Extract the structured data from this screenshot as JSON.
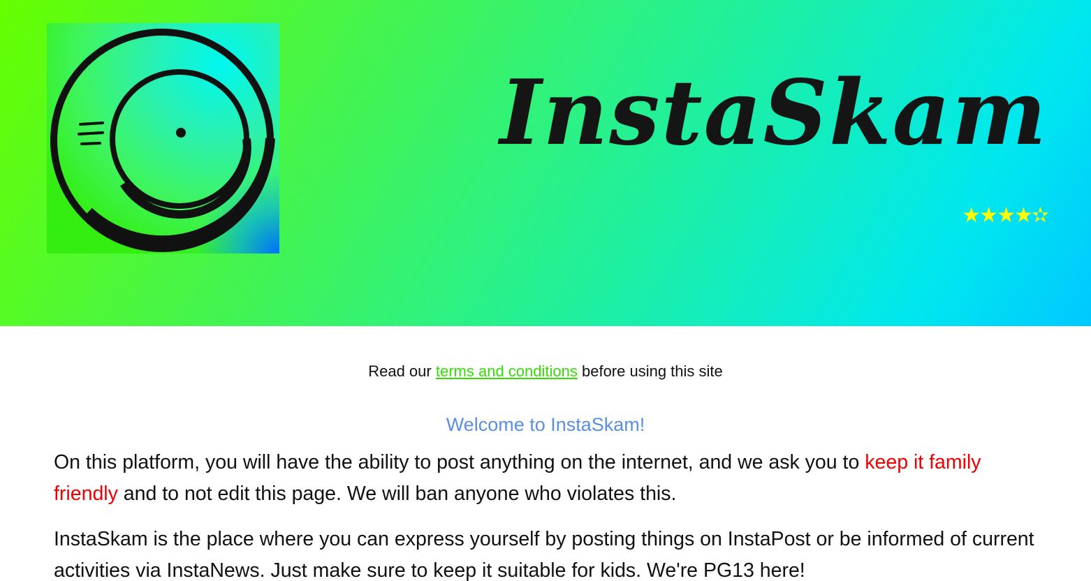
{
  "header": {
    "logo_alt": "InstaSkam logo",
    "title": "InstaSkam",
    "rating": {
      "value": 4.5,
      "max": 5,
      "display": "★★★★✫"
    }
  },
  "notice": {
    "prefix": "Read our",
    "link_label": "terms and conditions",
    "suffix": "before using this site"
  },
  "welcome": "Welcome to InstaSkam!",
  "paragraphs": {
    "p1_before": "On this platform, you will have the ability to post anything on the internet, and we ask you to",
    "p1_highlight": "keep it family friendly",
    "p1_after": "and to not edit this page. We will ban anyone who violates this.",
    "p2": "InstaSkam is the place where you can express yourself by posting things on InstaPost or be informed of current activities via InstaNews. Just make sure to keep it suitable for kids. We're PG13 here!"
  },
  "colors": {
    "link": "#33dd00",
    "welcome": "#5b8fe6",
    "highlight": "#ee0000",
    "stars": "#ffff00"
  }
}
